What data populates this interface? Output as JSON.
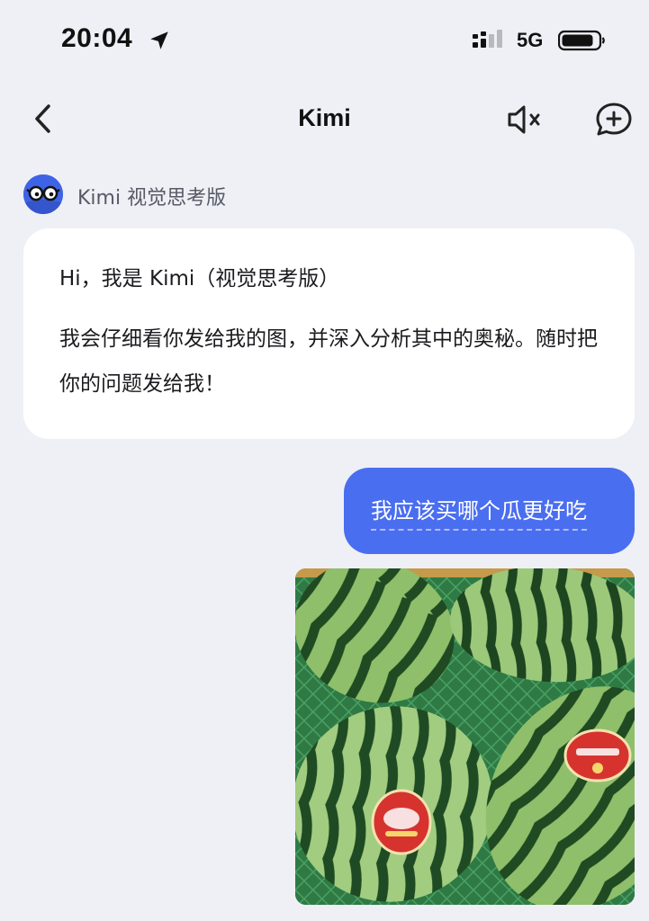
{
  "status_bar": {
    "time": "20:04",
    "network": "5G",
    "location_icon": "location-arrow-icon",
    "signal_icon": "signal-bars-icon",
    "battery_icon": "battery-icon"
  },
  "nav": {
    "title": "Kimi",
    "back_icon": "chevron-left-icon",
    "mute_icon": "speaker-muted-icon",
    "new_chat_icon": "chat-plus-icon"
  },
  "bot": {
    "name": "Kimi 视觉思考版",
    "avatar_icon": "glasses-avatar-icon",
    "greeting": "Hi，我是 Kimi（视觉思考版）",
    "intro": "我会仔细看你发给我的图，并深入分析其中的奥秘。随时把你的问题发给我！"
  },
  "user": {
    "message": "我应该买哪个瓜更好吃",
    "image": "watermelon-photo"
  },
  "colors": {
    "background": "#eff0f5",
    "bot_bubble": "#ffffff",
    "user_bubble": "#4a6ef0",
    "avatar": "#3f63e6"
  }
}
